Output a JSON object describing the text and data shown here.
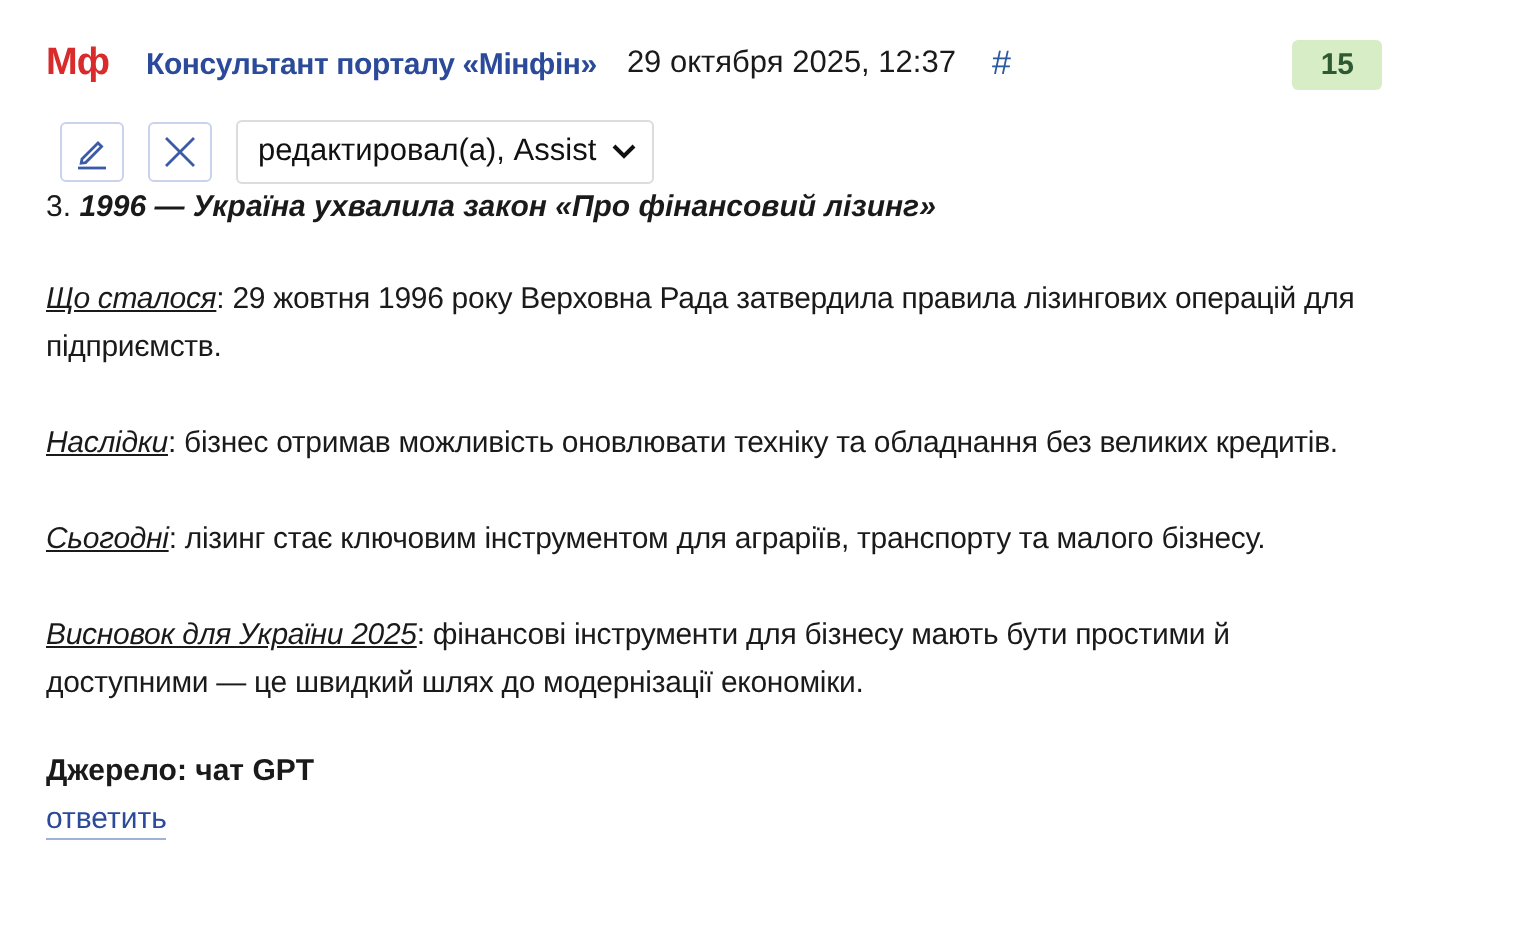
{
  "header": {
    "logo": "Мф",
    "author": "Консультант порталу «Мінфін»",
    "date": "29 октября 2025, 12:37",
    "anchor": "#",
    "rating": "15"
  },
  "toolbar": {
    "history": "редактировал(а), Assist"
  },
  "post": {
    "number": "3.",
    "title": "1996 — Україна ухвалила закон «Про фінансовий лізинг»",
    "paragraphs": [
      "*Що сталося*: 29 жовтня 1996 року Верховна Рада затвердила правила лізингових операцій для підприємств.",
      "*Наслідки*: бізнес отримав можливість оновлювати техніку та обладнання без великих кредитів.",
      "*Сьогодні*: лізинг стає ключовим інструментом для аграріїв, транспорту та малого бізнесу.",
      "*Висновок для України 2025*: фінансові інструменти для бізнесу мають бути простими й доступними — це швидкий шлях до модернізації економіки."
    ],
    "source": "Джерело: чат GPT"
  },
  "reply": "ответить"
}
